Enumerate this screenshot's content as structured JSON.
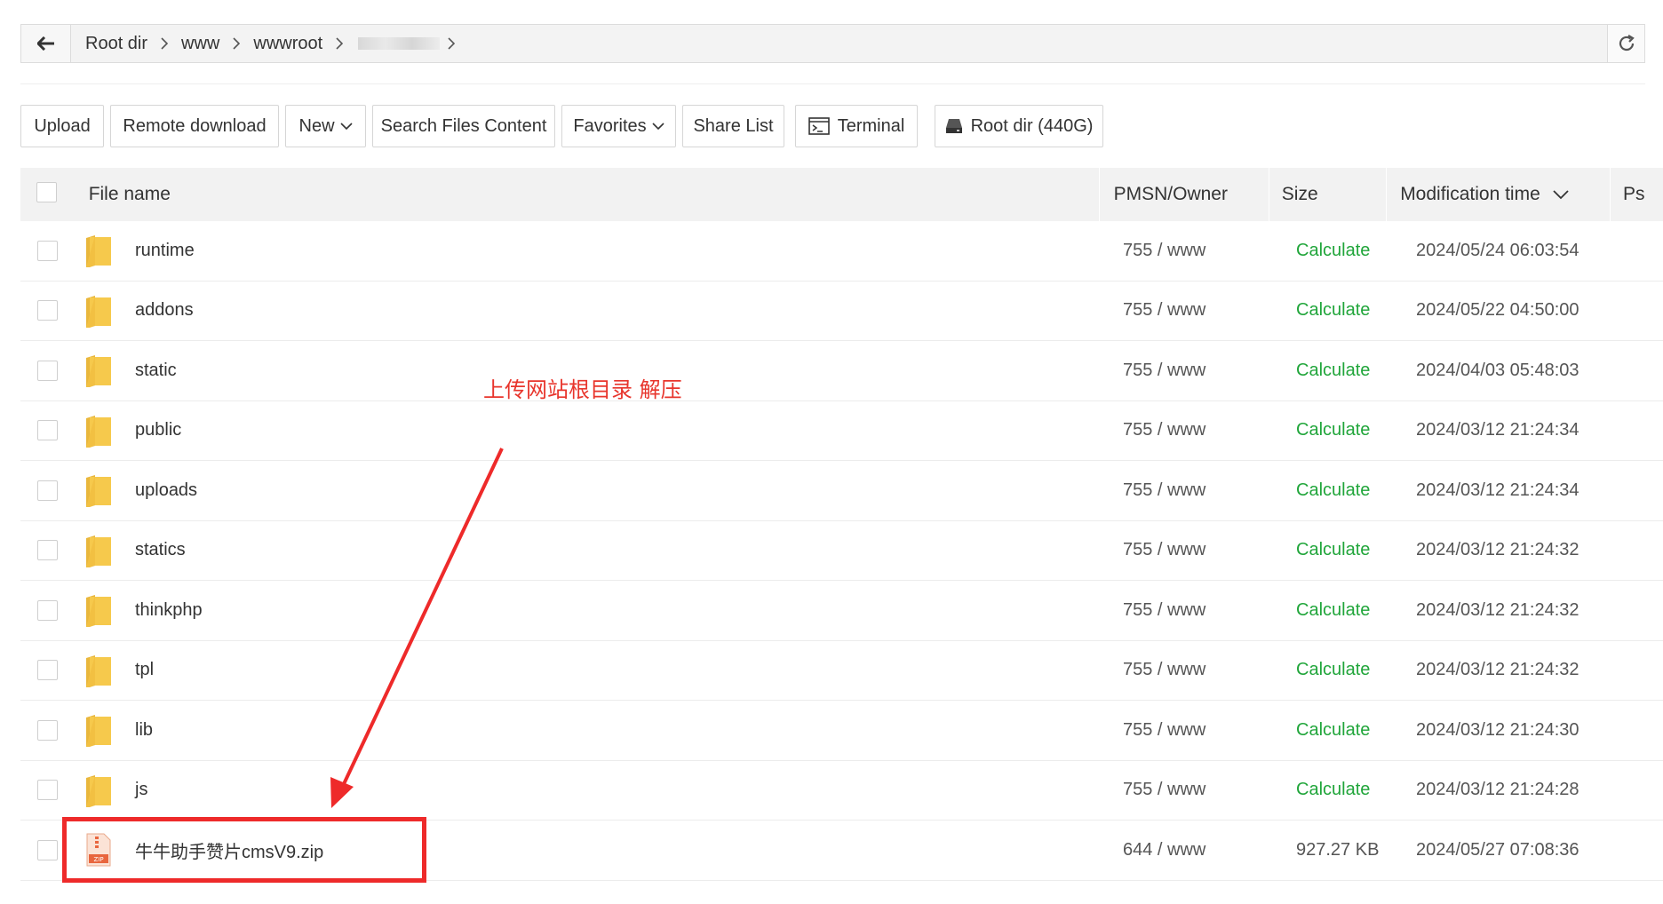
{
  "address_bar": {
    "crumbs": [
      "Root dir",
      "www",
      "wwwroot"
    ]
  },
  "toolbar": {
    "upload": "Upload",
    "remote_download": "Remote download",
    "new": "New",
    "search_files_content": "Search Files Content",
    "favorites": "Favorites",
    "share_list": "Share List",
    "terminal": "Terminal",
    "root_dir": "Root dir (440G)"
  },
  "table": {
    "headers": {
      "file_name": "File name",
      "owner": "PMSN/Owner",
      "size": "Size",
      "mtime": "Modification time",
      "ps": "Ps"
    },
    "rows": [
      {
        "name": "runtime",
        "perm": "755 / www",
        "size": "Calculate",
        "time": "2024/05/24 06:03:54",
        "type": "folder"
      },
      {
        "name": "addons",
        "perm": "755 / www",
        "size": "Calculate",
        "time": "2024/05/22 04:50:00",
        "type": "folder"
      },
      {
        "name": "static",
        "perm": "755 / www",
        "size": "Calculate",
        "time": "2024/04/03 05:48:03",
        "type": "folder"
      },
      {
        "name": "public",
        "perm": "755 / www",
        "size": "Calculate",
        "time": "2024/03/12 21:24:34",
        "type": "folder"
      },
      {
        "name": "uploads",
        "perm": "755 / www",
        "size": "Calculate",
        "time": "2024/03/12 21:24:34",
        "type": "folder"
      },
      {
        "name": "statics",
        "perm": "755 / www",
        "size": "Calculate",
        "time": "2024/03/12 21:24:32",
        "type": "folder"
      },
      {
        "name": "thinkphp",
        "perm": "755 / www",
        "size": "Calculate",
        "time": "2024/03/12 21:24:32",
        "type": "folder"
      },
      {
        "name": "tpl",
        "perm": "755 / www",
        "size": "Calculate",
        "time": "2024/03/12 21:24:32",
        "type": "folder"
      },
      {
        "name": "lib",
        "perm": "755 / www",
        "size": "Calculate",
        "time": "2024/03/12 21:24:30",
        "type": "folder"
      },
      {
        "name": "js",
        "perm": "755 / www",
        "size": "Calculate",
        "time": "2024/03/12 21:24:28",
        "type": "folder"
      },
      {
        "name": "牛牛助手赞片cmsV9.zip",
        "perm": "644 / www",
        "size": "927.27 KB",
        "time": "2024/05/27 07:08:36",
        "type": "zip"
      }
    ]
  },
  "annotation": {
    "text": "上传网站根目录 解压",
    "color": "#e8352c"
  },
  "colors": {
    "calculate": "#20a53a",
    "folder": "#f6c94c",
    "highlight": "#ee2a2a"
  },
  "icons": {
    "back": "arrow-left-icon",
    "refresh": "refresh-icon",
    "terminal": "terminal-icon",
    "disk": "disk-icon",
    "folder": "folder-icon",
    "zip": "zip-file-icon",
    "chevron": "chevron-down-icon"
  }
}
